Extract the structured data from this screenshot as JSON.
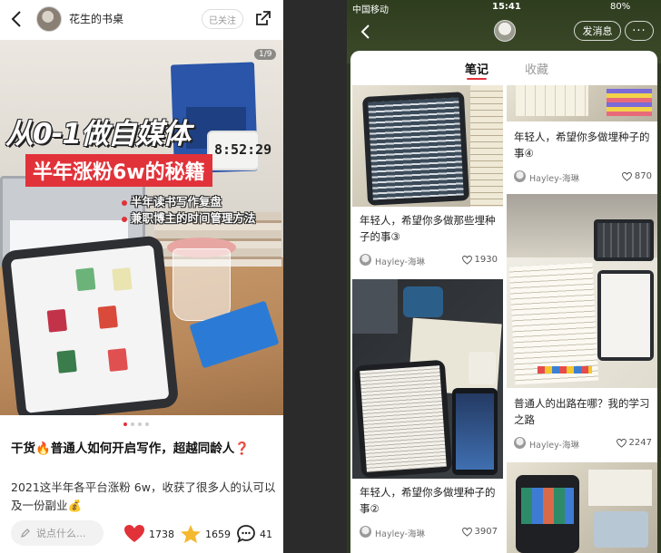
{
  "left": {
    "author": "花生的书桌",
    "follow_label": "已关注",
    "counter": "1/9",
    "image_title": "从0-1做自媒体",
    "image_subtitle": "半年涨粉6w的秘籍",
    "image_points": [
      "半年读书写作复盘",
      "兼职博主的时间管理方法"
    ],
    "clock_text": "8:52:29",
    "post_title": "干货🔥普通人如何开启写作，超越同龄人❓",
    "post_body": "2021这半年各平台涨粉 6w，收获了很多人的认可以及一份副业💰",
    "comment_placeholder": "说点什么...",
    "likes": "1738",
    "collects": "1659",
    "comments": "41"
  },
  "right": {
    "status": {
      "carrier": "中国移动",
      "time": "15:41",
      "battery": "80%"
    },
    "message_button": "发消息",
    "more_button": "···",
    "tabs": [
      "笔记",
      "收藏"
    ],
    "cards": [
      {
        "title": "年轻人，希望你多做那些埋种子的事③",
        "author": "Hayley-海琳",
        "likes": "1930"
      },
      {
        "title": "年轻人，希望你多做埋种子的事④",
        "author": "Hayley-海琳",
        "likes": "870"
      },
      {
        "title": "年轻人，希望你多做埋种子的事②",
        "author": "Hayley-海琳",
        "likes": "3907"
      },
      {
        "title": "普通人的出路在哪？我的学习之路",
        "author": "Hayley-海琳",
        "likes": "2247"
      }
    ]
  },
  "colors": {
    "accent": "#e1323a",
    "star": "#f5b82e"
  }
}
